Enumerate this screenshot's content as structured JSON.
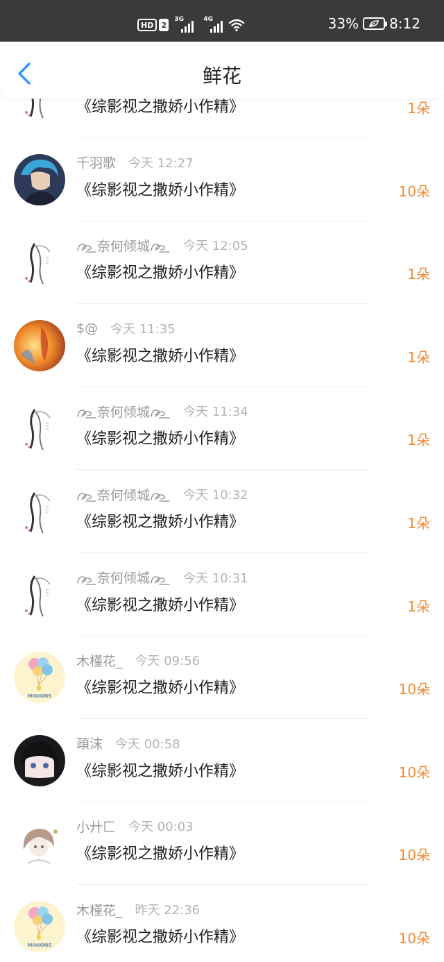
{
  "status_bar": {
    "hd": "HD",
    "sim": "2",
    "net1": "3G",
    "net2": "4G",
    "battery_percent": "33%",
    "time": "8:12"
  },
  "header": {
    "title": "鲜花",
    "back_icon": "chevron-left-icon"
  },
  "colors": {
    "accent": "#3399ff",
    "count": "#f08a35"
  },
  "rows": [
    {
      "name": "",
      "time": "",
      "book": "《综影视之撒娇小作精》",
      "count": "1朵",
      "avatar": "ink-painting"
    },
    {
      "name": "千羽歌",
      "time": "今天 12:27",
      "book": "《综影视之撒娇小作精》",
      "count": "10朵",
      "avatar": "blue-hair-man"
    },
    {
      "name": "奈何倾城",
      "time": "今天 12:05",
      "book": "《综影视之撒娇小作精》",
      "count": "1朵",
      "avatar": "ink-painting"
    },
    {
      "name": "$@",
      "time": "今天 11:35",
      "book": "《综影视之撒娇小作精》",
      "count": "1朵",
      "avatar": "fire-art"
    },
    {
      "name": "奈何倾城",
      "time": "今天 11:34",
      "book": "《综影视之撒娇小作精》",
      "count": "1朵",
      "avatar": "ink-painting"
    },
    {
      "name": "奈何倾城",
      "time": "今天 10:32",
      "book": "《综影视之撒娇小作精》",
      "count": "1朵",
      "avatar": "ink-painting"
    },
    {
      "name": "奈何倾城",
      "time": "今天 10:31",
      "book": "《综影视之撒娇小作精》",
      "count": "1朵",
      "avatar": "ink-painting"
    },
    {
      "name": "木槿花_",
      "time": "今天 09:56",
      "book": "《综影视之撒娇小作精》",
      "count": "10朵",
      "avatar": "minions-balloons",
      "avatar_text": "MINIONS"
    },
    {
      "name": "頙沫",
      "time": "今天 00:58",
      "book": "《综影视之撒娇小作精》",
      "count": "10朵",
      "avatar": "anime-girl-dark"
    },
    {
      "name": "小廾匚",
      "time": "今天 00:03",
      "book": "《综影视之撒娇小作精》",
      "count": "10朵",
      "avatar": "anime-girl-sketch"
    },
    {
      "name": "木槿花_",
      "time": "昨天 22:36",
      "book": "《综影视之撒娇小作精》",
      "count": "10朵",
      "avatar": "minions-balloons",
      "avatar_text": "MINIONS"
    }
  ]
}
